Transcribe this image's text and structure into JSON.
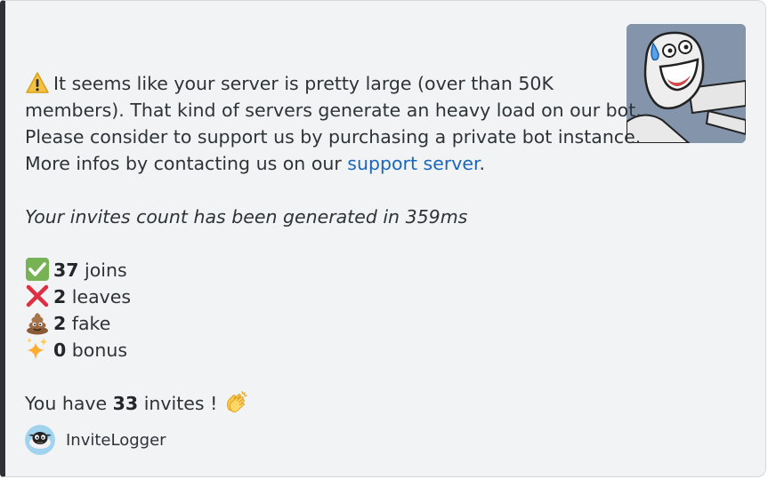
{
  "embed": {
    "accent_color": "#2f3136",
    "thumbnail_icon": "smiling-meme-face-image",
    "warning": {
      "icon": "warning-icon",
      "line1": "It seems like your server is pretty large (over than 50K",
      "line2": "members). That kind of servers generate an heavy load on our bot.",
      "line3": "Please consider to support us by purchasing a private bot instance.",
      "line4_prefix": "More infos by contacting us on our ",
      "link_text": "support server",
      "line4_suffix": "."
    },
    "timing_text": "Your invites count has been generated in 359ms",
    "stats": [
      {
        "icon": "check-icon",
        "count": "37",
        "label": " joins"
      },
      {
        "icon": "cross-icon",
        "count": "2",
        "label": " leaves"
      },
      {
        "icon": "poop-icon",
        "count": "2",
        "label": " fake"
      },
      {
        "icon": "sparkles-icon",
        "count": "0",
        "label": " bonus"
      }
    ],
    "summary": {
      "prefix": "You have ",
      "count": "33",
      "suffix": " invites ! ",
      "icon": "clapping-hands-icon"
    },
    "footer": {
      "icon": "invitelogger-avatar",
      "text": "InviteLogger"
    },
    "colors": {
      "background": "#f2f3f5",
      "text": "#2e3338",
      "link": "#1a66bd"
    }
  }
}
